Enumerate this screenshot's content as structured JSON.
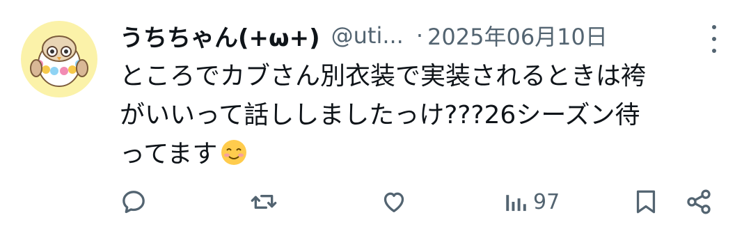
{
  "user": {
    "display_name": "うちちゃん(+ω+)",
    "handle": "@uti...",
    "separator": "·",
    "date": "2025年06月10日"
  },
  "post": {
    "line1": "ところでカブさん別衣装で実装されるときは袴",
    "line2": "がいいって話ししましたっけ???26シーズン待",
    "line3": "ってます",
    "emoji": "smiling-face-emoji"
  },
  "actions": {
    "reply_icon": "reply-icon",
    "repost_icon": "repost-icon",
    "like_icon": "heart-icon",
    "views_icon": "views-icon",
    "views_count": "97",
    "bookmark_icon": "bookmark-icon",
    "share_icon": "share-icon"
  },
  "colors": {
    "text": "#0f1419",
    "muted": "#536471",
    "avatar_bg": "#fbf2a9"
  }
}
